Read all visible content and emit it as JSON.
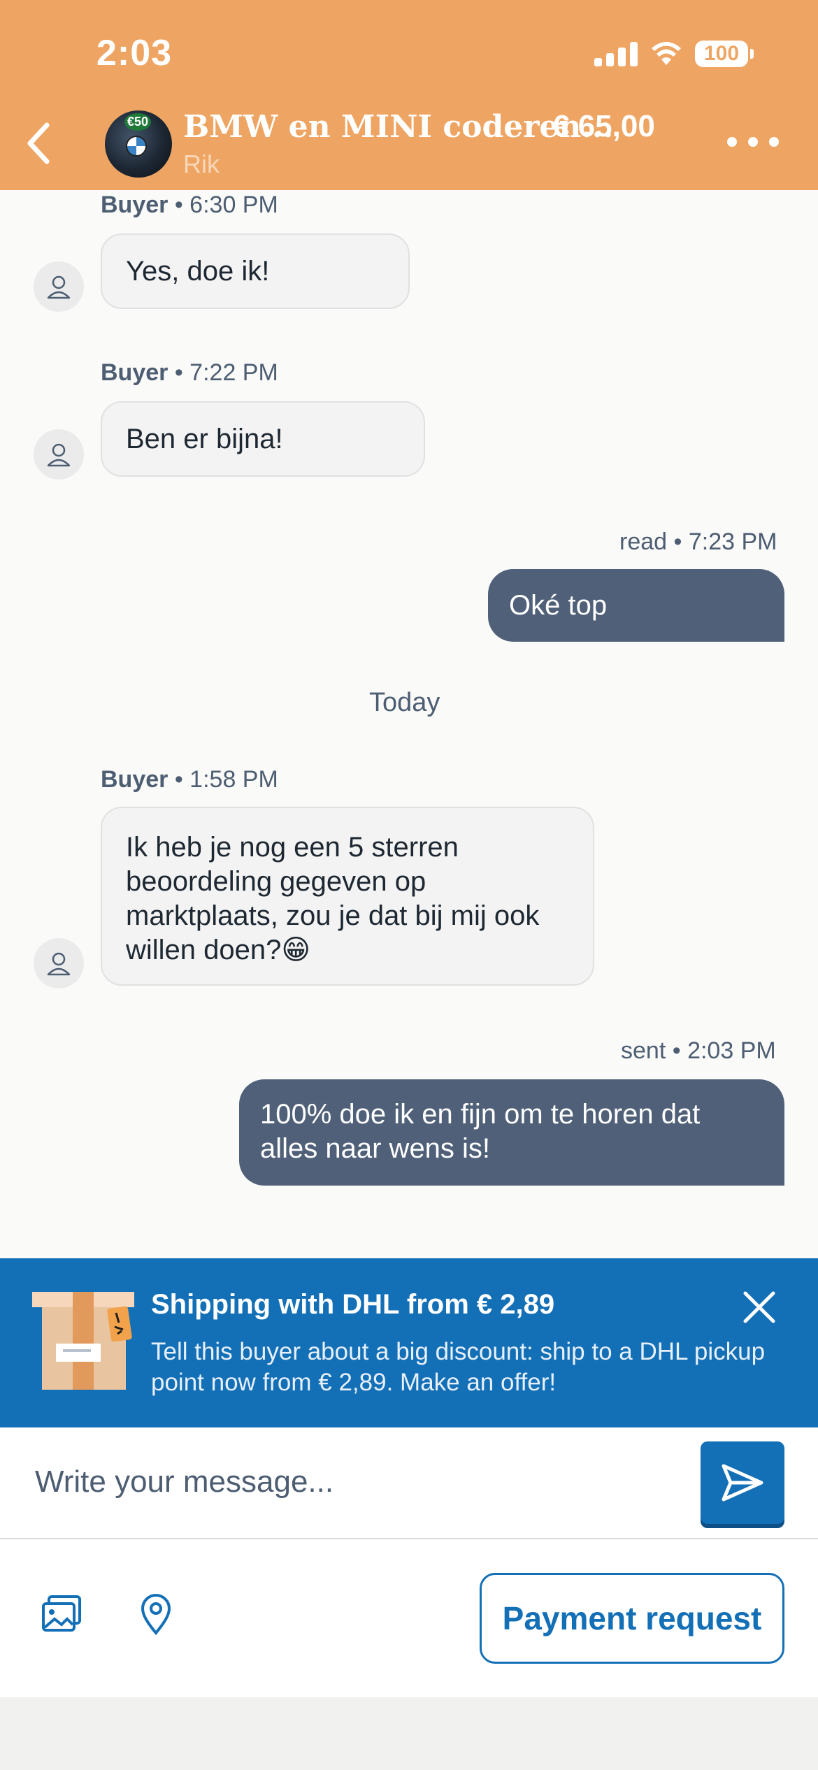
{
  "status_bar": {
    "time": "2:03",
    "battery": "100"
  },
  "header": {
    "listing_title": "BMW en MINI coderen...",
    "price": "€ 65,00",
    "seller": "Rik",
    "listing_badge": "€50"
  },
  "messages": [
    {
      "sender": "Buyer",
      "time": "• 6:30 PM",
      "text": "Yes, doe ik!"
    },
    {
      "sender": "Buyer",
      "time": "• 7:22 PM",
      "text": "Ben er bijna!"
    },
    {
      "status": "read",
      "time": "• 7:23 PM",
      "text": "Oké top"
    },
    {
      "sender": "Buyer",
      "time": "• 1:58 PM",
      "lines": [
        "Ik heb je nog een 5 sterren",
        "beoordeling gegeven op",
        "marktplaats, zou je dat bij mij ook",
        "willen doen?😁"
      ]
    },
    {
      "status": "sent",
      "time": "• 2:03 PM",
      "lines": [
        "100% doe ik en fijn om te horen dat",
        "alles naar wens is!"
      ]
    }
  ],
  "day_separator": "Today",
  "promo": {
    "title": "Shipping with DHL from € 2,89",
    "text_lines": [
      "Tell this buyer about a big discount: ship to a DHL pickup",
      "point now from € 2,89. Make an offer!"
    ]
  },
  "composer": {
    "placeholder": "Write your message..."
  },
  "actions": {
    "payment_request": "Payment request"
  },
  "icons": [
    "back-icon",
    "more-icon",
    "user-icon",
    "close-icon",
    "send-icon",
    "image-icon",
    "location-icon",
    "parcel-icon",
    "wifi-icon",
    "signal-icon"
  ],
  "colors": {
    "header": "#eea563",
    "outgoing_bubble": "#4f6078",
    "brand_blue": "#136fb6"
  }
}
